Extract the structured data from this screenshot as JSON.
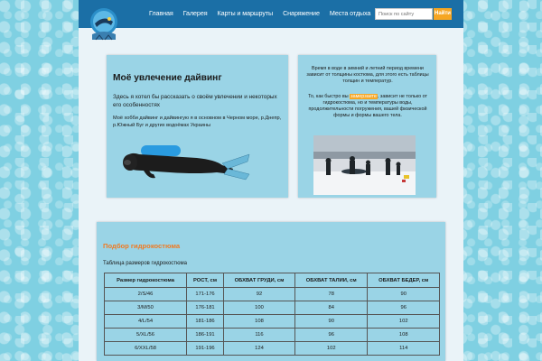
{
  "header": {
    "nav": [
      "Главная",
      "Галерея",
      "Карты и маршруты",
      "Снаряжение",
      "Места отдыха"
    ],
    "search_placeholder": "Поиск по сайту",
    "search_button": "Найти"
  },
  "hobby": {
    "title": "Моё увлечение дайвинг",
    "intro": "Здесь я хотел бы рассказать о своём увлечении и некоторых его особенностях",
    "text": "Моё хобби дайвинг и дайвингую я в основном в Черном море, р.Днепр, р.Южный Буг и других водоёмах Украины"
  },
  "season": {
    "text": "Время в воде в зимний и летний период времени зависит от толщины костюма, для этого есть таблицы толщин и температур.",
    "dress_before": "То, как быстро вы ",
    "dress_highlight": "замерзаете",
    "dress_after": ", зависит не только от гидрокостюма, но и температуры воды, продолжительности погружения, вашей физической формы и формы вашего тела."
  },
  "sizes": {
    "title": "Подбор гидрокостюма",
    "caption": "Таблица размеров гидрокостюма",
    "columns": [
      "Размер гидрокостюма",
      "РОСТ, см",
      "ОБХВАТ ГРУДИ, см",
      "ОБХВАТ ТАЛИИ, см",
      "ОБХВАТ БЕДЕР, см"
    ],
    "rows": [
      [
        "2/S/46",
        "171-176",
        "92",
        "78",
        "90"
      ],
      [
        "3/M/50",
        "176-181",
        "100",
        "84",
        "96"
      ],
      [
        "4/L/54",
        "181-186",
        "108",
        "90",
        "102"
      ],
      [
        "5/XL/56",
        "186-191",
        "116",
        "96",
        "108"
      ],
      [
        "6/XXL/58",
        "191-196",
        "124",
        "102",
        "114"
      ]
    ]
  }
}
